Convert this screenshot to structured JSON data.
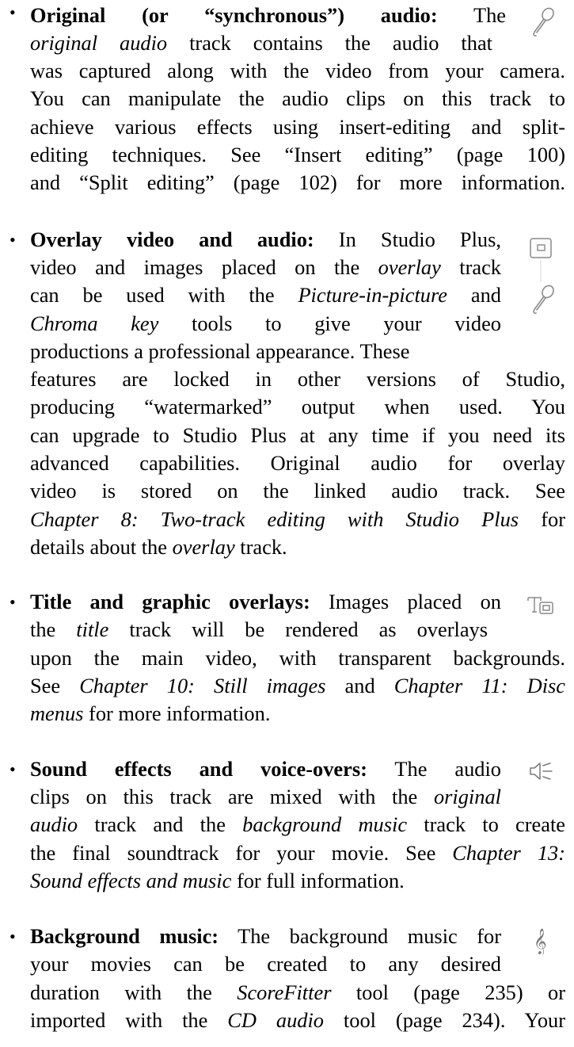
{
  "items": [
    {
      "id": "original-audio",
      "lines": [
        [
          {
            "t": "Original (or “synchronous”) audio:",
            "s": "b"
          },
          {
            "t": " The"
          }
        ],
        [
          {
            "t": "original audio",
            "s": "i"
          },
          {
            "t": " track contains the audio that"
          }
        ],
        [
          {
            "t": "was captured along with the video from your camera."
          }
        ],
        [
          {
            "t": "You can manipulate the audio clips on this track to"
          }
        ],
        [
          {
            "t": "achieve various effects using insert-editing and split-"
          }
        ],
        [
          {
            "t": "editing techniques. See “Insert editing” (page 100)"
          }
        ],
        [
          {
            "t": "and “Split editing” (page 102) for more information."
          }
        ]
      ],
      "icons": [
        "microphone-icon"
      ]
    },
    {
      "id": "overlay-video-audio",
      "lines": [
        [
          {
            "t": "Overlay video and audio:",
            "s": "b"
          },
          {
            "t": " In Studio Plus,"
          }
        ],
        [
          {
            "t": "video and images placed on the "
          },
          {
            "t": "overlay",
            "s": "i"
          },
          {
            "t": " track"
          }
        ],
        [
          {
            "t": "can be used with the "
          },
          {
            "t": "Picture-in-picture",
            "s": "i"
          },
          {
            "t": " and"
          }
        ],
        [
          {
            "t": "Chroma key",
            "s": "i"
          },
          {
            "t": " tools to give your video"
          }
        ],
        [
          {
            "t": "productions a professional appearance. These"
          }
        ],
        [
          {
            "t": "features are locked in other versions of Studio,"
          }
        ],
        [
          {
            "t": "producing “watermarked” output when used. You"
          }
        ],
        [
          {
            "t": "can upgrade to Studio Plus at any time if you need its"
          }
        ],
        [
          {
            "t": "advanced capabilities. Original audio for overlay"
          }
        ],
        [
          {
            "t": "video is stored on the linked audio track. See"
          }
        ],
        [
          {
            "t": "Chapter 8: Two-track editing with Studio Plus",
            "s": "i"
          },
          {
            "t": " for"
          }
        ],
        [
          {
            "t": "details about the "
          },
          {
            "t": "overlay",
            "s": "i"
          },
          {
            "t": " track."
          }
        ]
      ],
      "icons": [
        "overlay-video-icon",
        "microphone-icon"
      ]
    },
    {
      "id": "title-graphic-overlays",
      "lines": [
        [
          {
            "t": "Title and graphic overlays:",
            "s": "b"
          },
          {
            "t": " Images placed on"
          }
        ],
        [
          {
            "t": "the "
          },
          {
            "t": "title",
            "s": "i"
          },
          {
            "t": " track will be rendered as overlays"
          }
        ],
        [
          {
            "t": "upon the main video, with transparent backgrounds."
          }
        ],
        [
          {
            "t": "See "
          },
          {
            "t": "Chapter 10: Still images",
            "s": "i"
          },
          {
            "t": " and "
          },
          {
            "t": "Chapter 11: Disc",
            "s": "i"
          }
        ],
        [
          {
            "t": "menus",
            "s": "i"
          },
          {
            "t": " for more information."
          }
        ]
      ],
      "icons": [
        "title-track-icon"
      ]
    },
    {
      "id": "sound-effects",
      "lines": [
        [
          {
            "t": "Sound effects and voice-overs:",
            "s": "b"
          },
          {
            "t": " The audio"
          }
        ],
        [
          {
            "t": "clips on this track are mixed with the "
          },
          {
            "t": "original",
            "s": "i"
          }
        ],
        [
          {
            "t": "audio",
            "s": "i"
          },
          {
            "t": " track and the "
          },
          {
            "t": "background music",
            "s": "i"
          },
          {
            "t": " track to create"
          }
        ],
        [
          {
            "t": "the final soundtrack for your movie. See "
          },
          {
            "t": "Chapter 13:",
            "s": "i"
          }
        ],
        [
          {
            "t": "Sound effects and music",
            "s": "i"
          },
          {
            "t": " for full information."
          }
        ]
      ],
      "icons": [
        "speaker-icon"
      ]
    },
    {
      "id": "background-music",
      "lines": [
        [
          {
            "t": "Background music:",
            "s": "b"
          },
          {
            "t": " The background music for"
          }
        ],
        [
          {
            "t": "your movies can be created to any desired"
          }
        ],
        [
          {
            "t": "duration with the "
          },
          {
            "t": "ScoreFitter",
            "s": "i"
          },
          {
            "t": " tool (page 235) or"
          }
        ],
        [
          {
            "t": "imported with the "
          },
          {
            "t": "CD audio",
            "s": "i"
          },
          {
            "t": " tool (page 234). Your"
          }
        ]
      ],
      "icons": [
        "treble-clef-icon"
      ]
    }
  ]
}
